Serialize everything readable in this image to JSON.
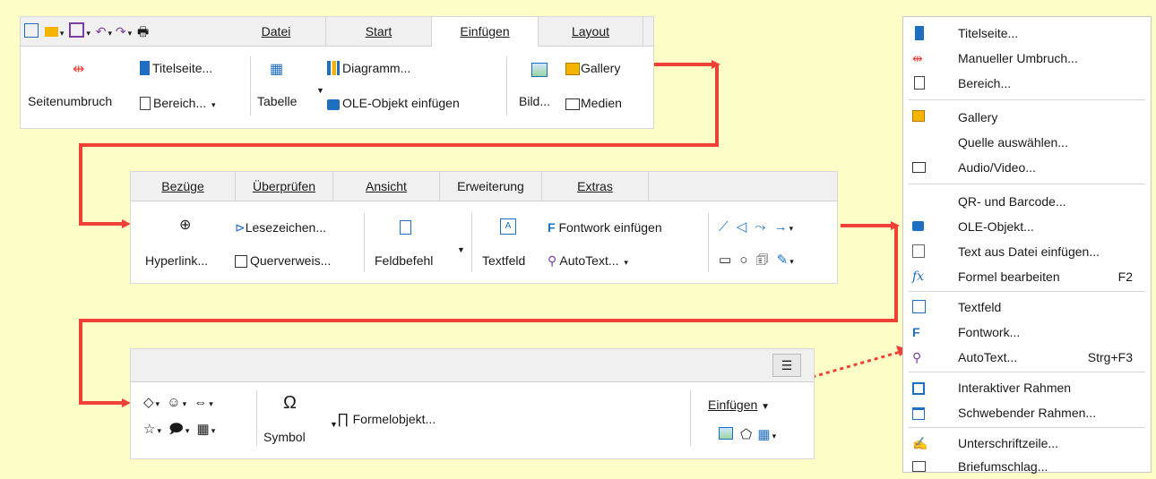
{
  "panel1": {
    "tabs": [
      "Datei",
      "Start",
      "Einfügen",
      "Layout"
    ],
    "items": {
      "seitenumbruch": "Seitenumbruch",
      "titelseite": "Titelseite...",
      "bereich": "Bereich...",
      "tabelle": "Tabelle",
      "diagramm": "Diagramm...",
      "ole": "OLE-Objekt einfügen",
      "bild": "Bild...",
      "gallery": "Gallery",
      "medien": "Medien"
    }
  },
  "panel2": {
    "tabs": [
      "Bezüge",
      "Überprüfen",
      "Ansicht",
      "Erweiterung",
      "Extras"
    ],
    "items": {
      "hyperlink": "Hyperlink...",
      "lesezeichen": "Lesezeichen...",
      "querverweis": "Querverweis...",
      "feldbefehl": "Feldbefehl",
      "textfeld": "Textfeld",
      "fontwork": "Fontwork einfügen",
      "autotext": "AutoText..."
    }
  },
  "panel3": {
    "items": {
      "symbol": "Symbol",
      "formelobjekt": "Formelobjekt...",
      "einfuegen": "Einfügen"
    }
  },
  "menu": {
    "items": [
      {
        "label": "Titelseite...",
        "icon": "title-page-icon"
      },
      {
        "label": "Manueller Umbruch...",
        "icon": "manual-break-icon"
      },
      {
        "label": "Bereich...",
        "icon": "section-icon"
      },
      {
        "label": "Gallery",
        "icon": "gallery-icon"
      },
      {
        "label": "Quelle auswählen...",
        "icon": ""
      },
      {
        "label": "Audio/Video...",
        "icon": "media-icon"
      },
      {
        "label": "QR- und Barcode...",
        "icon": ""
      },
      {
        "label": "OLE-Objekt...",
        "icon": "ole-object-icon"
      },
      {
        "label": "Text aus Datei einfügen...",
        "icon": "text-from-file-icon"
      },
      {
        "label": "Formel bearbeiten",
        "icon": "formula-icon",
        "accel": "F2"
      },
      {
        "label": "Textfeld",
        "icon": "text-box-icon"
      },
      {
        "label": "Fontwork...",
        "icon": "fontwork-icon"
      },
      {
        "label": "AutoText...",
        "icon": "autotext-icon",
        "accel": "Strg+F3"
      },
      {
        "label": "Interaktiver Rahmen",
        "icon": "interactive-frame-icon"
      },
      {
        "label": "Schwebender Rahmen...",
        "icon": "floating-frame-icon"
      },
      {
        "label": "Unterschriftzeile...",
        "icon": "signature-line-icon"
      },
      {
        "label": "Briefumschlag...",
        "icon": "envelope-icon"
      }
    ]
  },
  "colors": {
    "accent": "#ef4136",
    "background": "#fdfdc8",
    "icon_blue": "#1e6fc0"
  }
}
